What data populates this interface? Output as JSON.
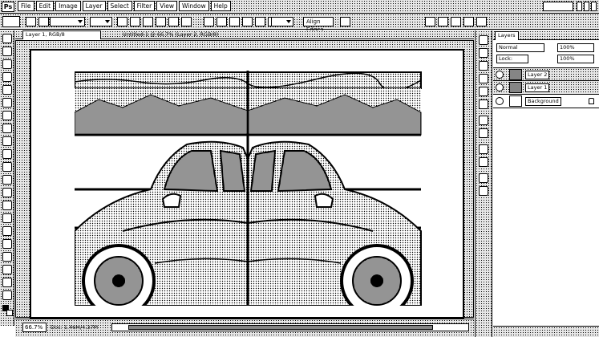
{
  "app": {
    "logo_text": "Ps",
    "menu": [
      "File",
      "Edit",
      "Image",
      "Layer",
      "Select",
      "Filter",
      "View",
      "Window",
      "Help"
    ]
  },
  "options_bar": {
    "align_edges_label": "Align Edges"
  },
  "document": {
    "tab_label": "Layer 1, RGB/8",
    "tab_info": "Untitled-1 @ 66.7% (Layer 2, RGB/8)",
    "zoom": "66.7%",
    "status_info": "Doc: 1.46M/4.37M"
  },
  "layers_panel": {
    "tab_label": "Layers",
    "blend_mode": "Normal",
    "opacity": "100%",
    "fill": "100%",
    "lock_label": "Lock:",
    "layers": [
      {
        "name": "Layer 2"
      },
      {
        "name": "Layer 1"
      },
      {
        "name": "Background"
      }
    ]
  },
  "colors": {
    "chrome": "#e6e6e6",
    "outline": "#000000",
    "canvas": "#ffffff"
  },
  "icons": [
    "move-tool-icon",
    "eye-icon",
    "lock-icon",
    "zoom-icon",
    "hand-icon"
  ]
}
